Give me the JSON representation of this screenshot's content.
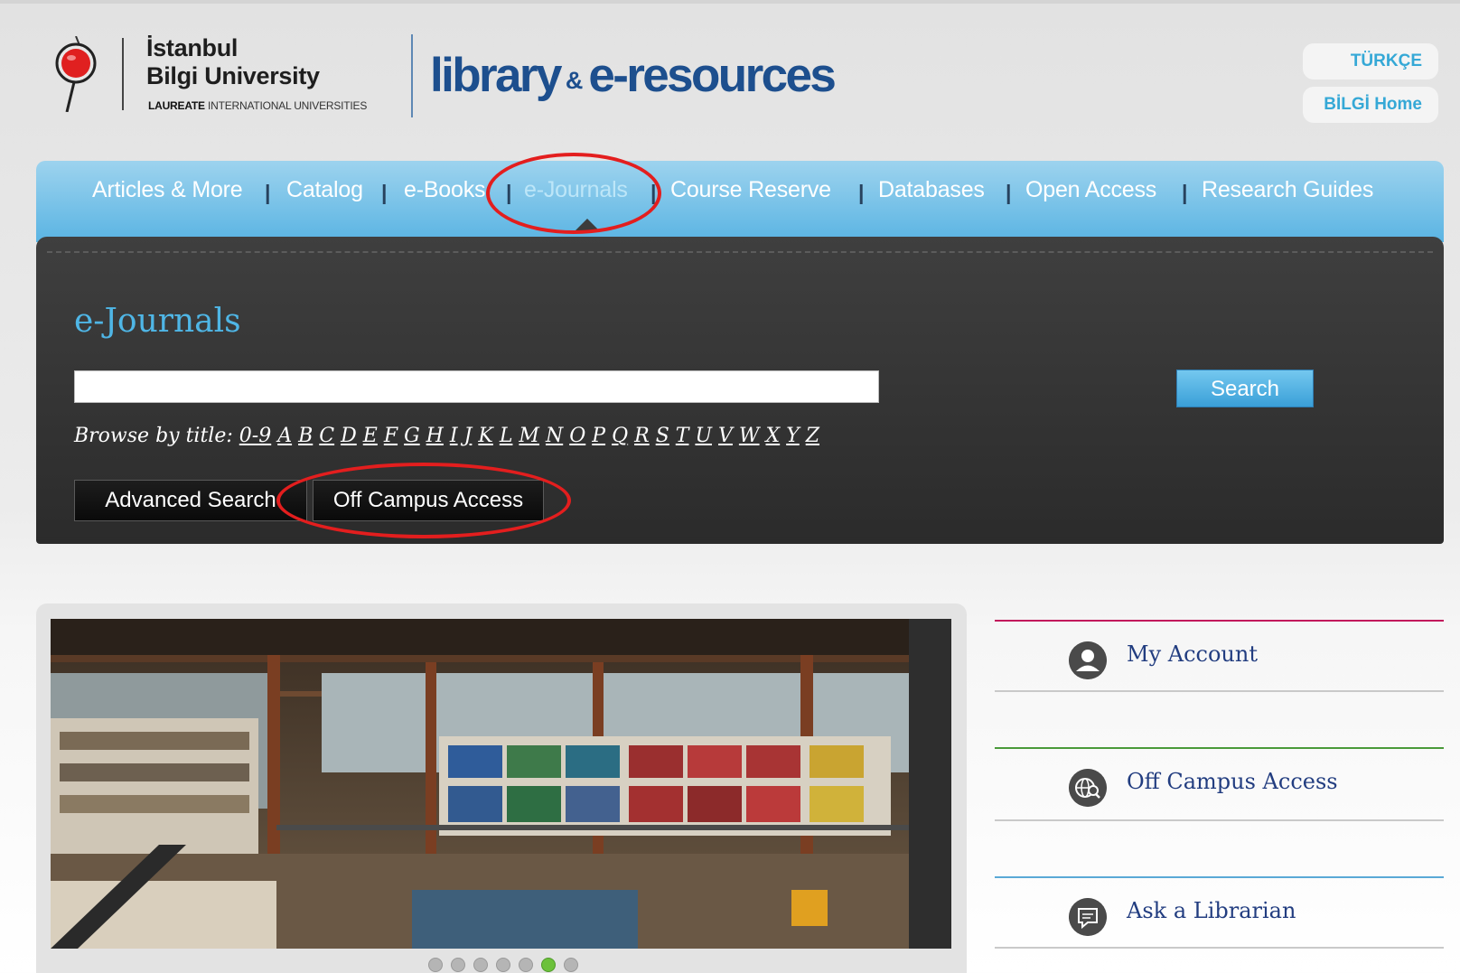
{
  "header": {
    "university_line1": "İstanbul",
    "university_line2": "Bilgi University",
    "laureate_bold": "LAUREATE",
    "laureate_rest": "INTERNATIONAL UNIVERSITIES",
    "brand_library": "library",
    "brand_amp": "&",
    "brand_eres": "e-resources",
    "util_turkce": "TÜRKÇE",
    "util_home": "BİLGİ Home"
  },
  "nav": {
    "items": [
      {
        "label": "Articles & More"
      },
      {
        "label": "Catalog"
      },
      {
        "label": "e-Books"
      },
      {
        "label": "e-Journals"
      },
      {
        "label": "Course Reserve"
      },
      {
        "label": "Databases"
      },
      {
        "label": "Open Access"
      },
      {
        "label": "Research Guides"
      }
    ],
    "separator": "|",
    "active": "e-Journals"
  },
  "search": {
    "title": "e-Journals",
    "input_value": "",
    "button_label": "Search",
    "browse_label": "Browse by title:",
    "letters": [
      "0-9",
      "A",
      "B",
      "C",
      "D",
      "E",
      "F",
      "G",
      "H",
      "I",
      "J",
      "K",
      "L",
      "M",
      "N",
      "O",
      "P",
      "Q",
      "R",
      "S",
      "T",
      "U",
      "V",
      "W",
      "X",
      "Y",
      "Z"
    ],
    "advanced_label": "Advanced Search",
    "offcampus_label": "Off Campus Access"
  },
  "slider": {
    "dots_count": 7,
    "active_dot": 5
  },
  "quicklinks": [
    {
      "label": "My Account",
      "icon": "user-icon",
      "color": "#c2185b"
    },
    {
      "label": "Off Campus Access",
      "icon": "globe-search-icon",
      "color": "#4a9a3a"
    },
    {
      "label": "Ask a Librarian",
      "icon": "chat-icon",
      "color": "#5aa9d6"
    }
  ],
  "colors": {
    "brand_blue": "#1d4f8e",
    "nav_blue": "#5ab4e3",
    "accent_cyan": "#4fb6e6",
    "panel_dark": "#333333",
    "annotation_red": "#e31e1e"
  }
}
